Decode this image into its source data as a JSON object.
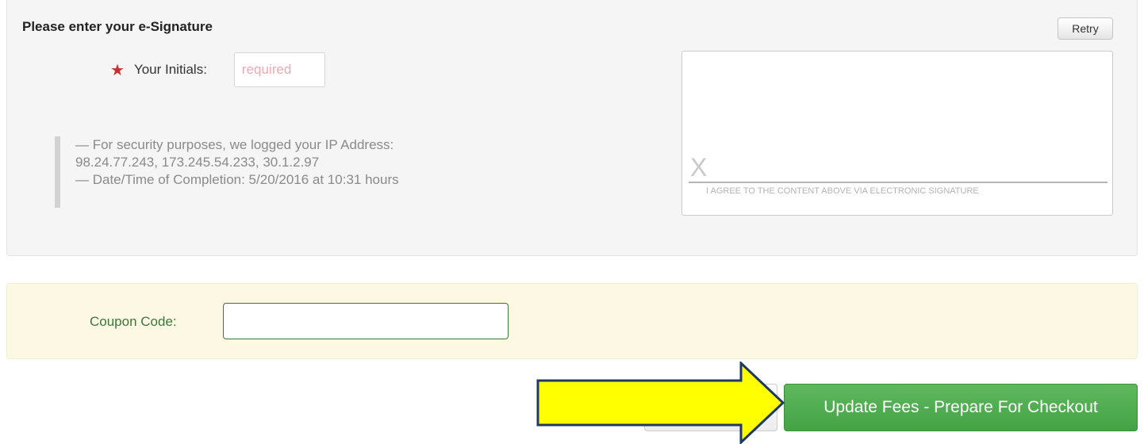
{
  "esignature": {
    "title": "Please enter your e-Signature",
    "retry_label": "Retry",
    "initials_label": "Your Initials:",
    "initials_placeholder": "required",
    "initials_value": "",
    "audit": {
      "ip_line": "— For security purposes, we logged your IP Address:",
      "ip_addresses": "98.24.77.243, 173.245.54.233, 30.1.2.97",
      "datetime_line": "— Date/Time of Completion: 5/20/2016 at 10:31 hours"
    },
    "pad": {
      "x_mark": "X",
      "agreement_caption": "I AGREE TO THE CONTENT ABOVE VIA ELECTRONIC SIGNATURE"
    }
  },
  "coupon": {
    "label": "Coupon Code:",
    "value": ""
  },
  "actions": {
    "update_label": "Update Fees - Prepare For Checkout"
  },
  "colors": {
    "required_star": "#c9302c",
    "coupon_label": "#3c763d",
    "coupon_panel_bg": "#fcf8e3",
    "update_button": "#4cae4c",
    "arrow_fill": "#ffff00",
    "arrow_stroke": "#1f3864"
  },
  "icons": {
    "required": "star-icon",
    "callout": "arrow-right-icon"
  }
}
